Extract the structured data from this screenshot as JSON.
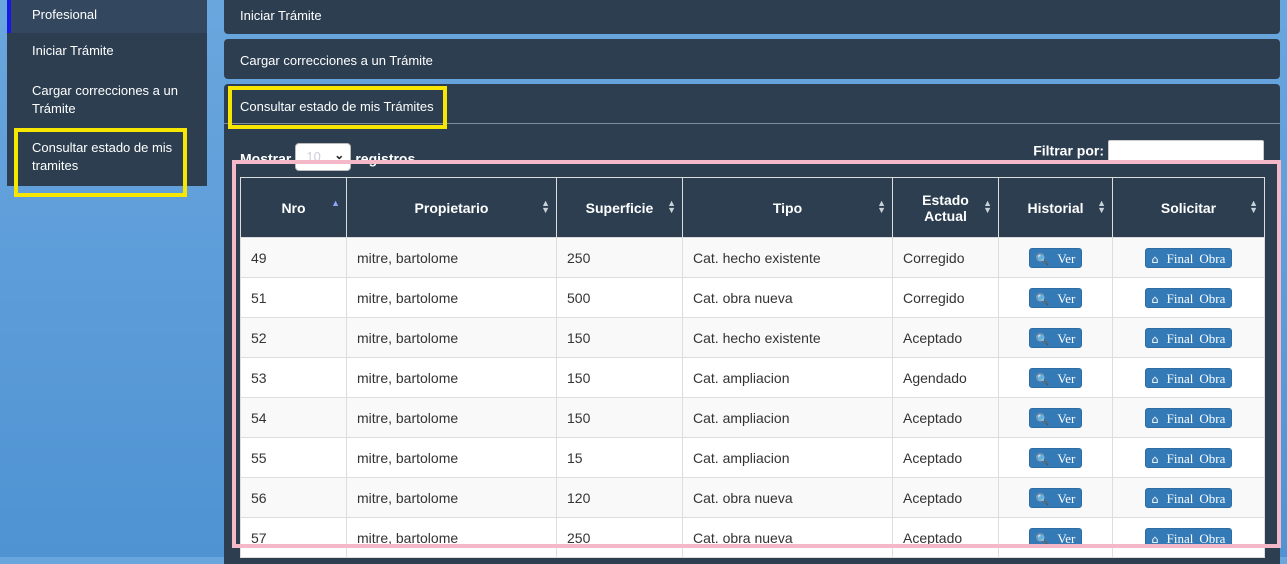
{
  "sidebar": {
    "items": [
      {
        "label": "Profesional"
      },
      {
        "label": "Iniciar Trámite"
      },
      {
        "label": "Cargar correcciones a un Trámite"
      },
      {
        "label": "Consultar estado de mis tramites"
      }
    ]
  },
  "panels": {
    "iniciar": "Iniciar Trámite",
    "cargar": "Cargar correcciones a un Trámite",
    "consultar": "Consultar estado de mis Trámites"
  },
  "controls": {
    "mostrar_label": "Mostrar",
    "mostrar_value": "10",
    "registros_label": "registros",
    "filtrar_label": "Filtrar por:",
    "filtrar_value": ""
  },
  "table": {
    "headers": [
      "Nro",
      "Propietario",
      "Superficie",
      "Tipo",
      "Estado Actual",
      "Historial",
      "Solicitar"
    ],
    "ver_label": "Ver",
    "final_label": "Final",
    "obra_label": "Obra",
    "rows": [
      {
        "nro": "49",
        "propietario": "mitre, bartolome",
        "superficie": "250",
        "tipo": "Cat. hecho existente",
        "estado": "Corregido"
      },
      {
        "nro": "51",
        "propietario": "mitre, bartolome",
        "superficie": "500",
        "tipo": "Cat. obra nueva",
        "estado": "Corregido"
      },
      {
        "nro": "52",
        "propietario": "mitre, bartolome",
        "superficie": "150",
        "tipo": "Cat. hecho existente",
        "estado": "Aceptado"
      },
      {
        "nro": "53",
        "propietario": "mitre, bartolome",
        "superficie": "150",
        "tipo": "Cat. ampliacion",
        "estado": "Agendado"
      },
      {
        "nro": "54",
        "propietario": "mitre, bartolome",
        "superficie": "150",
        "tipo": "Cat. ampliacion",
        "estado": "Aceptado"
      },
      {
        "nro": "55",
        "propietario": "mitre, bartolome",
        "superficie": "15",
        "tipo": "Cat. ampliacion",
        "estado": "Aceptado"
      },
      {
        "nro": "56",
        "propietario": "mitre, bartolome",
        "superficie": "120",
        "tipo": "Cat. obra nueva",
        "estado": "Aceptado"
      },
      {
        "nro": "57",
        "propietario": "mitre, bartolome",
        "superficie": "250",
        "tipo": "Cat. obra nueva",
        "estado": "Aceptado"
      }
    ]
  },
  "colors": {
    "panel_bg": "#2c3e50",
    "button_blue": "#337ab7",
    "highlight_yellow": "#f7e700",
    "highlight_pink": "#f4b8c9"
  }
}
